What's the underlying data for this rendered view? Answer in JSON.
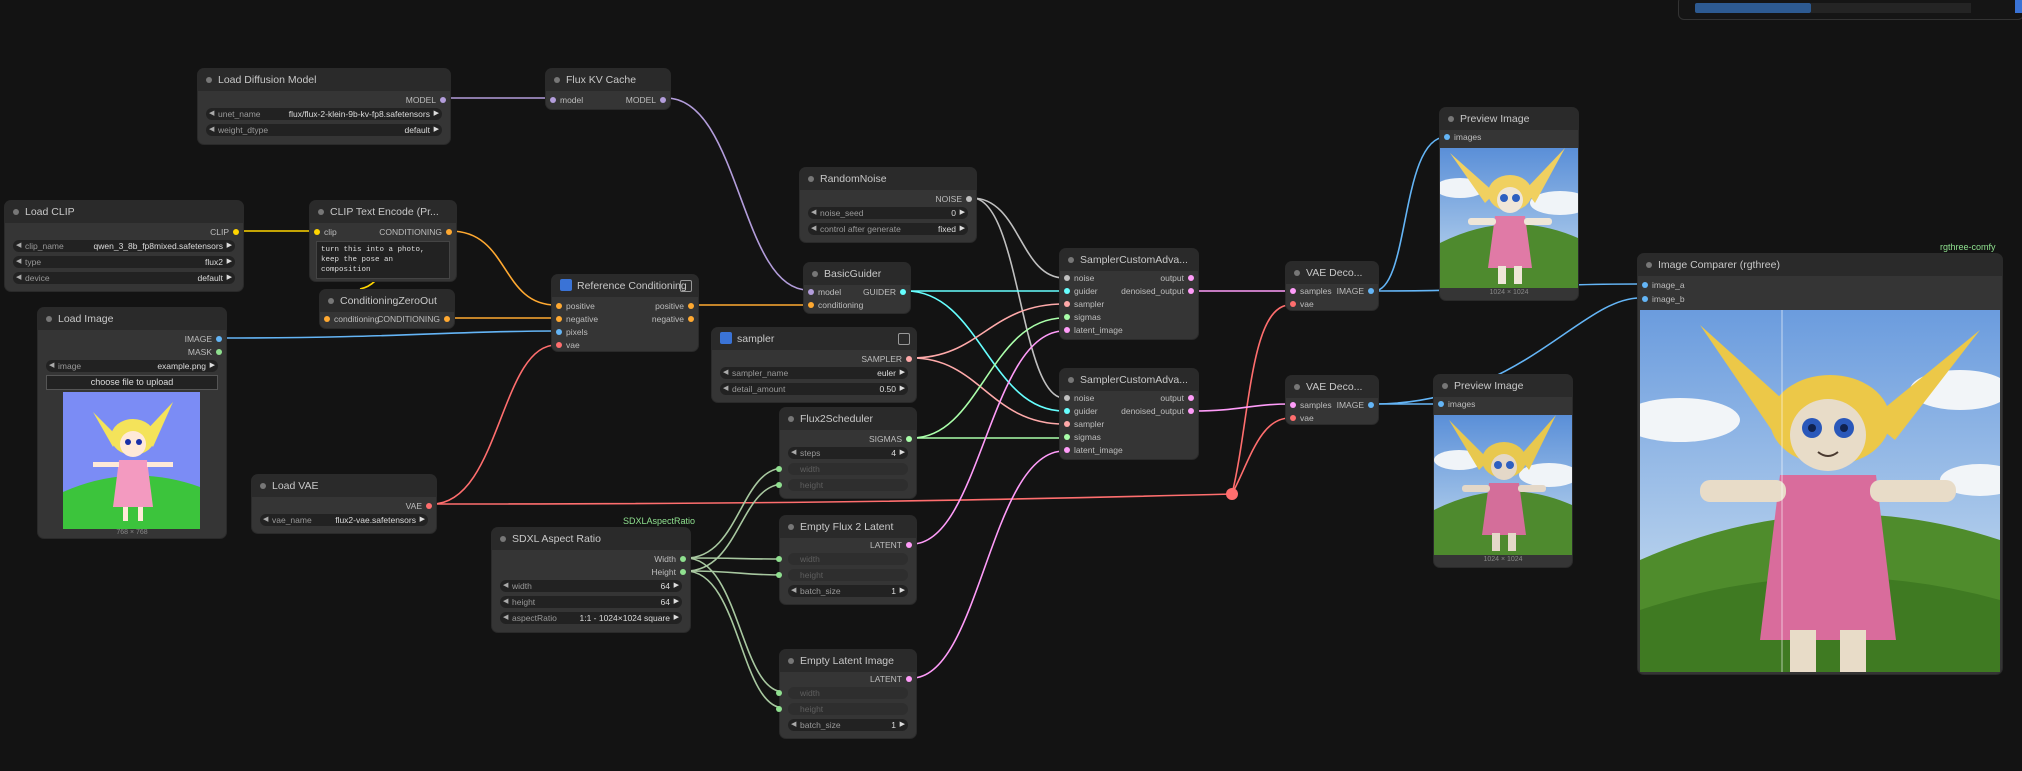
{
  "colors": {
    "model": "#b39ddb",
    "clip": "#ffd500",
    "cond": "#ffa931",
    "image": "#64b5f6",
    "vae": "#ff6e6e",
    "noise": "#c0c0c0",
    "guider": "#66ffff",
    "sampler": "#ffaaaa",
    "sigmas": "#aaffaa",
    "latent": "#ff9cf9",
    "int": "#8fe08f",
    "reroute": "#ff6e6e"
  },
  "nodes": {
    "load_diffusion": {
      "title": "Load Diffusion Model",
      "out_model": "MODEL",
      "w1_label": "unet_name",
      "w1_value": "flux/flux-2-klein-9b-kv-fp8.safetensors",
      "w2_label": "weight_dtype",
      "w2_value": "default"
    },
    "flux_kv": {
      "title": "Flux KV Cache",
      "in_model": "model",
      "out_model": "MODEL"
    },
    "load_clip": {
      "title": "Load CLIP",
      "out_clip": "CLIP",
      "w1_label": "clip_name",
      "w1_value": "qwen_3_8b_fp8mixed.safetensors",
      "w2_label": "type",
      "w2_value": "flux2",
      "w3_label": "device",
      "w3_value": "default"
    },
    "clip_encode": {
      "title": "CLIP Text Encode (Pr...",
      "in_clip": "clip",
      "out_cond": "CONDITIONING",
      "text": "turn this into a photo, keep the pose an composition"
    },
    "cond_zero": {
      "title": "ConditioningZeroOut",
      "in_cond": "conditioning",
      "out_cond": "CONDITIONING"
    },
    "load_image": {
      "title": "Load Image",
      "out_image": "IMAGE",
      "out_mask": "MASK",
      "w1_label": "image",
      "w1_value": "example.png",
      "upload": "choose file to upload",
      "caption": "768 × 768"
    },
    "ref_cond": {
      "title": "Reference Conditioning",
      "in1": "positive",
      "in2": "negative",
      "in3": "pixels",
      "in4": "vae",
      "out1": "positive",
      "out2": "negative"
    },
    "load_vae": {
      "title": "Load VAE",
      "out_vae": "VAE",
      "w1_label": "vae_name",
      "w1_value": "flux2-vae.safetensors"
    },
    "random_noise": {
      "title": "RandomNoise",
      "out_noise": "NOISE",
      "w1_label": "noise_seed",
      "w1_value": "0",
      "w2_label": "control after generate",
      "w2_value": "fixed"
    },
    "basic_guider": {
      "title": "BasicGuider",
      "in1": "model",
      "in2": "conditioning",
      "out": "GUIDER"
    },
    "sampler": {
      "title": "sampler",
      "out": "SAMPLER",
      "w1_label": "sampler_name",
      "w1_value": "euler",
      "w2_label": "detail_amount",
      "w2_value": "0.50"
    },
    "flux2_sched": {
      "title": "Flux2Scheduler",
      "out": "SIGMAS",
      "w1_label": "steps",
      "w1_value": "4",
      "w2_label": "width",
      "w3_label": "height"
    },
    "sdxl_aspect": {
      "badge": "SDXLAspectRatio",
      "title": "SDXL Aspect Ratio",
      "out1": "Width",
      "out2": "Height",
      "w1_label": "width",
      "w1_value": "64",
      "w2_label": "height",
      "w2_value": "64",
      "w3_label": "aspectRatio",
      "w3_value": "1:1 - 1024×1024 square"
    },
    "empty_flux2": {
      "title": "Empty Flux 2 Latent",
      "out": "LATENT",
      "w1_label": "width",
      "w2_label": "height",
      "w3_label": "batch_size",
      "w3_value": "1"
    },
    "empty_latent": {
      "title": "Empty Latent Image",
      "out": "LATENT",
      "w1_label": "width",
      "w2_label": "height",
      "w3_label": "batch_size",
      "w3_value": "1"
    },
    "sampler_adv1": {
      "title": "SamplerCustomAdva...",
      "in1": "noise",
      "in2": "guider",
      "in3": "sampler",
      "in4": "sigmas",
      "in5": "latent_image",
      "out1": "output",
      "out2": "denoised_output"
    },
    "sampler_adv2": {
      "title": "SamplerCustomAdva...",
      "in1": "noise",
      "in2": "guider",
      "in3": "sampler",
      "in4": "sigmas",
      "in5": "latent_image",
      "out1": "output",
      "out2": "denoised_output"
    },
    "vae_decode1": {
      "title": "VAE Deco...",
      "in1": "samples",
      "in2": "vae",
      "out": "IMAGE"
    },
    "vae_decode2": {
      "title": "VAE Deco...",
      "in1": "samples",
      "in2": "vae",
      "out": "IMAGE"
    },
    "preview1": {
      "title": "Preview Image",
      "in": "images",
      "caption": "1024 × 1024"
    },
    "preview2": {
      "title": "Preview Image",
      "in": "images",
      "caption": "1024 × 1024"
    },
    "comparer": {
      "badge": "rgthree-comfy",
      "title": "Image Comparer (rgthree)",
      "in1": "image_a",
      "in2": "image_b"
    }
  },
  "icons": [
    "node-collapse-dot-icon",
    "node-expand-icon",
    "node-group-badge-icon",
    "widget-arrow-left-icon",
    "widget-arrow-right-icon"
  ]
}
